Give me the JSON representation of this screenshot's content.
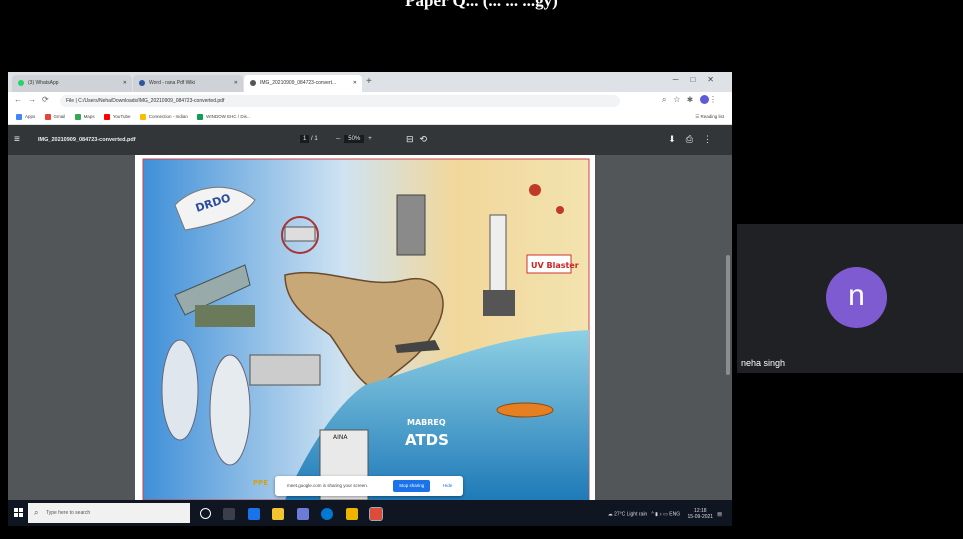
{
  "caption": "Paper Q... (... ... ...gy)",
  "browser": {
    "tabs": [
      {
        "label": "(3) WhatsApp",
        "active": false,
        "color": "#25d366"
      },
      {
        "label": "Word - rana Pdf Wiki",
        "active": false,
        "color": "#2b579a"
      },
      {
        "label": "IMG_20210909_084723-convert...",
        "active": true,
        "color": "#555555"
      }
    ],
    "url": "File | C:/Users/Neha/Downloads/IMG_20210909_084723-converted.pdf",
    "bookmarks": [
      {
        "label": "Apps",
        "color": "#4285f4"
      },
      {
        "label": "Gmail",
        "color": "#ea4335"
      },
      {
        "label": "Maps",
        "color": "#34a853"
      },
      {
        "label": "YouTube",
        "color": "#ff0000"
      },
      {
        "label": "Connection - Indian",
        "color": "#fbbc04"
      },
      {
        "label": "WINDOW EHC / Dis...",
        "color": "#0f9d58"
      }
    ],
    "reading_list": "Reading list"
  },
  "pdf": {
    "filename": "IMG_20210909_084723-converted.pdf",
    "page_current": "1",
    "page_total": "/ 1",
    "zoom": "50%"
  },
  "poster": {
    "drdo": "DRDO",
    "uv_blaster": "UV Blaster",
    "aina": "AINA",
    "mabrequ": "MABREQ",
    "atds": "ATDS",
    "ppe": "PPE"
  },
  "share_banner": {
    "message": "meet.google.com is sharing your screen.",
    "stop": "Stop sharing",
    "hide": "Hide"
  },
  "taskbar": {
    "search_placeholder": "Type here to search",
    "weather": "27°C Light rain",
    "lang": "ENG",
    "time": "12:18",
    "date": "15-09-2021"
  },
  "participant": {
    "initial": "n",
    "name": "neha singh"
  }
}
